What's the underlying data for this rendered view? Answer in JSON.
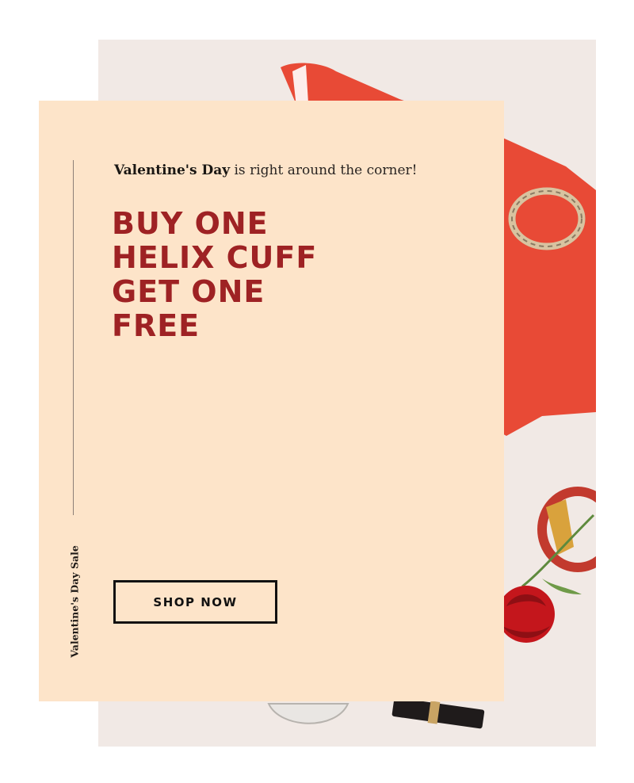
{
  "promo": {
    "intro_bold": "Valentine's Day",
    "intro_rest": " is right around the corner!",
    "headline_lines": [
      "BUY ONE",
      "HELIX CUFF",
      "GET ONE",
      "FREE"
    ],
    "cta_label": "SHOP NOW",
    "side_label": "Valentine's Day Sale"
  },
  "colors": {
    "panel_bg": "#fde4c9",
    "headline": "#9e2224",
    "cta_border": "#111111",
    "photo_bg": "#f1e9e5"
  },
  "icons": {
    "photo": "product-photo-image"
  }
}
